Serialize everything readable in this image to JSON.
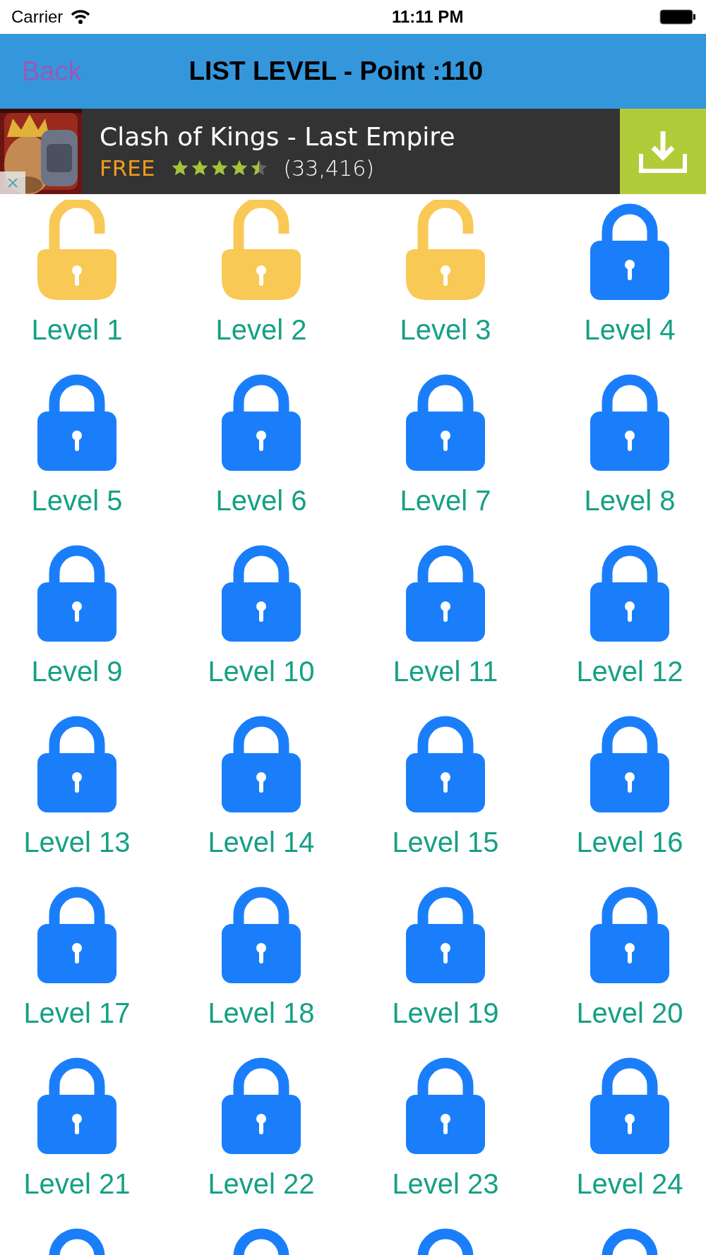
{
  "status_bar": {
    "carrier": "Carrier",
    "time": "11:11 PM"
  },
  "nav": {
    "back": "Back",
    "title": "LIST LEVEL - Point :110"
  },
  "ad": {
    "close": "×",
    "title": "Clash of Kings - Last Empire",
    "price": "FREE",
    "stars": 4.5,
    "reviews": "(33,416)"
  },
  "levels": [
    {
      "label": "Level 1",
      "locked": false
    },
    {
      "label": "Level 2",
      "locked": false
    },
    {
      "label": "Level 3",
      "locked": false
    },
    {
      "label": "Level 4",
      "locked": true
    },
    {
      "label": "Level 5",
      "locked": true
    },
    {
      "label": "Level 6",
      "locked": true
    },
    {
      "label": "Level 7",
      "locked": true
    },
    {
      "label": "Level 8",
      "locked": true
    },
    {
      "label": "Level 9",
      "locked": true
    },
    {
      "label": "Level 10",
      "locked": true
    },
    {
      "label": "Level 11",
      "locked": true
    },
    {
      "label": "Level 12",
      "locked": true
    },
    {
      "label": "Level 13",
      "locked": true
    },
    {
      "label": "Level 14",
      "locked": true
    },
    {
      "label": "Level 15",
      "locked": true
    },
    {
      "label": "Level 16",
      "locked": true
    },
    {
      "label": "Level 17",
      "locked": true
    },
    {
      "label": "Level 18",
      "locked": true
    },
    {
      "label": "Level 19",
      "locked": true
    },
    {
      "label": "Level 20",
      "locked": true
    },
    {
      "label": "Level 21",
      "locked": true
    },
    {
      "label": "Level 22",
      "locked": true
    },
    {
      "label": "Level 23",
      "locked": true
    },
    {
      "label": "Level 24",
      "locked": true
    },
    {
      "locked": true
    },
    {
      "locked": true
    },
    {
      "locked": true
    },
    {
      "locked": true
    }
  ]
}
